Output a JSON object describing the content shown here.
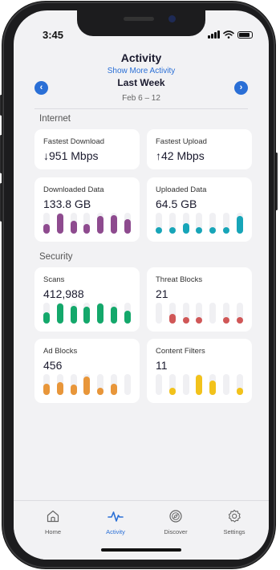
{
  "status": {
    "time": "3:45"
  },
  "header": {
    "title": "Activity",
    "show_more": "Show More Activity",
    "period": "Last Week",
    "dates": "Feb 6 – 12",
    "prev_icon": "chevron-left-icon",
    "next_icon": "chevron-right-icon"
  },
  "internet": {
    "section_label": "Internet",
    "fastest_download": {
      "label": "Fastest Download",
      "value": "↓951 Mbps"
    },
    "fastest_upload": {
      "label": "Fastest Upload",
      "value": "↑42 Mbps"
    },
    "downloaded": {
      "label": "Downloaded Data",
      "value": "133.8 GB",
      "color": "#8e4b8f",
      "levels": [
        0.45,
        0.95,
        0.6,
        0.45,
        0.85,
        0.9,
        0.7
      ]
    },
    "uploaded": {
      "label": "Uploaded Data",
      "value": "64.5 GB",
      "color": "#17a5b8",
      "levels": [
        0.25,
        0.25,
        0.5,
        0.25,
        0.25,
        0.25,
        0.85
      ]
    }
  },
  "security": {
    "section_label": "Security",
    "scans": {
      "label": "Scans",
      "value": "412,988",
      "color": "#14a86b",
      "levels": [
        0.55,
        0.95,
        0.85,
        0.8,
        0.95,
        0.8,
        0.6
      ]
    },
    "threat_blocks": {
      "label": "Threat Blocks",
      "value": "21",
      "color": "#d05757",
      "levels": [
        0,
        0.45,
        0.25,
        0.25,
        0,
        0.25,
        0.25
      ]
    },
    "ad_blocks": {
      "label": "Ad Blocks",
      "value": "456",
      "color": "#e8963a",
      "levels": [
        0.55,
        0.6,
        0.5,
        0.9,
        0.35,
        0.55,
        0
      ]
    },
    "content_filters": {
      "label": "Content Filters",
      "value": "11",
      "color": "#f2c21b",
      "levels": [
        0,
        0.35,
        0,
        0.95,
        0.7,
        0,
        0.35
      ]
    }
  },
  "tabbar": {
    "items": [
      {
        "label": "Home",
        "icon": "home-icon"
      },
      {
        "label": "Activity",
        "icon": "activity-icon"
      },
      {
        "label": "Discover",
        "icon": "compass-icon"
      },
      {
        "label": "Settings",
        "icon": "gear-icon"
      }
    ],
    "active": "Activity",
    "accent": "#2a6fd6"
  }
}
